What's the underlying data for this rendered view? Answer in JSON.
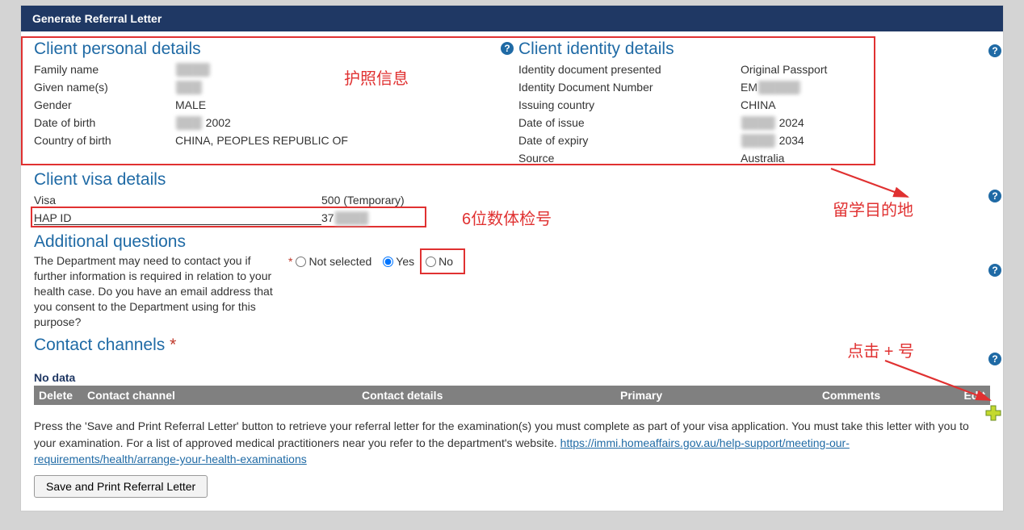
{
  "header": {
    "title": "Generate Referral Letter"
  },
  "annotations": {
    "passport_info": "护照信息",
    "hap_note": "6位数体检号",
    "destination": "留学目的地",
    "plus_note": "点击 + 号"
  },
  "personal": {
    "title": "Client personal details",
    "family_name_label": "Family name",
    "family_name_value": "████",
    "given_names_label": "Given name(s)",
    "given_names_value": "███",
    "gender_label": "Gender",
    "gender_value": "MALE",
    "dob_label": "Date of birth",
    "dob_value_pre": "███",
    "dob_value_year": " 2002",
    "cob_label": "Country of birth",
    "cob_value": "CHINA, PEOPLES REPUBLIC OF"
  },
  "identity": {
    "title": "Client identity details",
    "doc_presented_label": "Identity document presented",
    "doc_presented_value": "Original Passport",
    "doc_number_label": "Identity Document Number",
    "doc_number_prefix": "EM",
    "doc_number_rest": "█████",
    "issuing_country_label": "Issuing country",
    "issuing_country_value": "CHINA",
    "issue_date_label": "Date of issue",
    "issue_date_pre": "████",
    "issue_date_year": " 2024",
    "expiry_date_label": "Date of expiry",
    "expiry_date_pre": "████",
    "expiry_date_year": " 2034",
    "source_label": "Source",
    "source_value": "Australia"
  },
  "visa": {
    "title": "Client visa details",
    "visa_label": "Visa",
    "visa_value": "500 (Temporary)",
    "hap_label": "HAP ID",
    "hap_prefix": "37",
    "hap_rest": "████"
  },
  "questions": {
    "title": "Additional questions",
    "text": "The Department may need to contact you if further information is required in relation to your health case. Do you have an email address that you consent to the Department using for this purpose?",
    "opt_not_selected": "Not selected",
    "opt_yes": "Yes",
    "opt_no": "No"
  },
  "contact": {
    "title": "Contact channels",
    "no_data": "No data",
    "th_delete": "Delete",
    "th_channel": "Contact channel",
    "th_details": "Contact details",
    "th_primary": "Primary",
    "th_comments": "Comments",
    "th_edit": "Edit"
  },
  "instructions": {
    "text_a": "Press the 'Save and Print Referral Letter' button to retrieve your referral letter for the examination(s) you must complete as part of your visa application. You must take this letter with you to your examination. For a list of approved medical practitioners near you refer to the department's website. ",
    "link_text": "https://immi.homeaffairs.gov.au/help-support/meeting-our-requirements/health/arrange-your-health-examinations"
  },
  "buttons": {
    "save_print": "Save and Print Referral Letter"
  }
}
